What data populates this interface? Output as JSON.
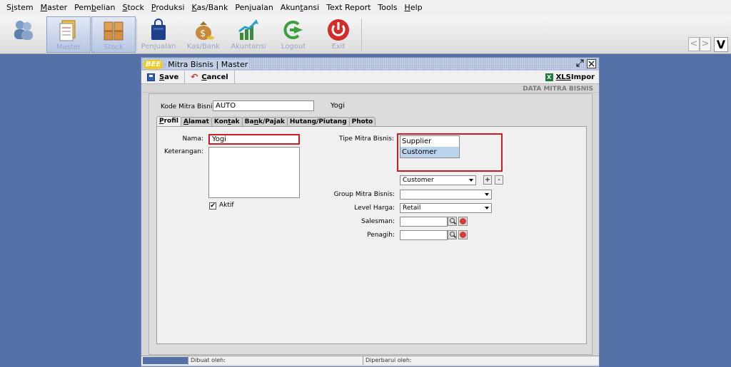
{
  "menu": {
    "items": [
      {
        "pre": "S",
        "u": "i",
        "post": "stem"
      },
      {
        "pre": "",
        "u": "M",
        "post": "aster"
      },
      {
        "pre": "Pem",
        "u": "b",
        "post": "elian"
      },
      {
        "pre": "",
        "u": "S",
        "post": "tock"
      },
      {
        "pre": "",
        "u": "P",
        "post": "roduksi"
      },
      {
        "pre": "",
        "u": "K",
        "post": "as/Bank"
      },
      {
        "pre": "Pen",
        "u": "j",
        "post": "ualan"
      },
      {
        "pre": "Akun",
        "u": "t",
        "post": "ansi"
      },
      {
        "pre": "Text Report",
        "u": "",
        "post": ""
      },
      {
        "pre": "Tools",
        "u": "",
        "post": ""
      },
      {
        "pre": "",
        "u": "H",
        "post": "elp"
      }
    ]
  },
  "toolbar": {
    "buttons": [
      {
        "icon": "users-icon",
        "label": ""
      },
      {
        "icon": "master-documents-icon",
        "label": "Master"
      },
      {
        "icon": "boxes-icon",
        "label": "Stock"
      },
      {
        "icon": "shopping-bag-icon",
        "label": "Penjualan"
      },
      {
        "icon": "money-bag-icon",
        "label": "Kas/Bank"
      },
      {
        "icon": "chart-growth-icon",
        "label": "Akuntansi"
      },
      {
        "icon": "logout-arrow-icon",
        "label": "Logout"
      },
      {
        "icon": "power-icon",
        "label": "Exit"
      }
    ],
    "prev": "<",
    "next": ">",
    "logo": "V"
  },
  "window": {
    "logo": "BEE",
    "title": "Mitra Bisnis | Master",
    "save": {
      "u": "S",
      "post": "ave"
    },
    "cancel": {
      "u": "C",
      "post": "ancel"
    },
    "xls": {
      "u": "XLS",
      "post": " Impor"
    },
    "section_title": "DATA MITRA BISNIS",
    "kode_label": "Kode Mitra Bisnis:",
    "kode_value": "AUTO",
    "kode_name": "Yogi",
    "tabs": [
      {
        "pre": "",
        "u": "P",
        "post": "rofil"
      },
      {
        "pre": "",
        "u": "A",
        "post": "lamat"
      },
      {
        "pre": "Kon",
        "u": "t",
        "post": "ak"
      },
      {
        "pre": "Ba",
        "u": "n",
        "post": "k/Pajak"
      },
      {
        "pre": "Hutang/Piutang",
        "u": "",
        "post": ""
      },
      {
        "pre": "Photo",
        "u": "",
        "post": ""
      }
    ],
    "nama_label": "Nama:",
    "nama_value": "Yogi",
    "keterangan_label": "Keterangan:",
    "aktif_label": "Aktif",
    "aktif_checked": "✔",
    "tipe_label": "Tipe Mitra Bisnis:",
    "tipe_options": [
      "Supplier",
      "Customer"
    ],
    "tipe_selected": "Customer",
    "tipe_combo_value": "Customer",
    "add": "+",
    "remove": "-",
    "group_label": "Group Mitra Bisnis:",
    "group_value": "",
    "level_label": "Level Harga:",
    "level_value": "Retail",
    "salesman_label": "Salesman:",
    "penagih_label": "Penagih:",
    "dibuat_label": "Dibuat oleh:",
    "diperbarui_label": "Diperbarui oleh:"
  }
}
